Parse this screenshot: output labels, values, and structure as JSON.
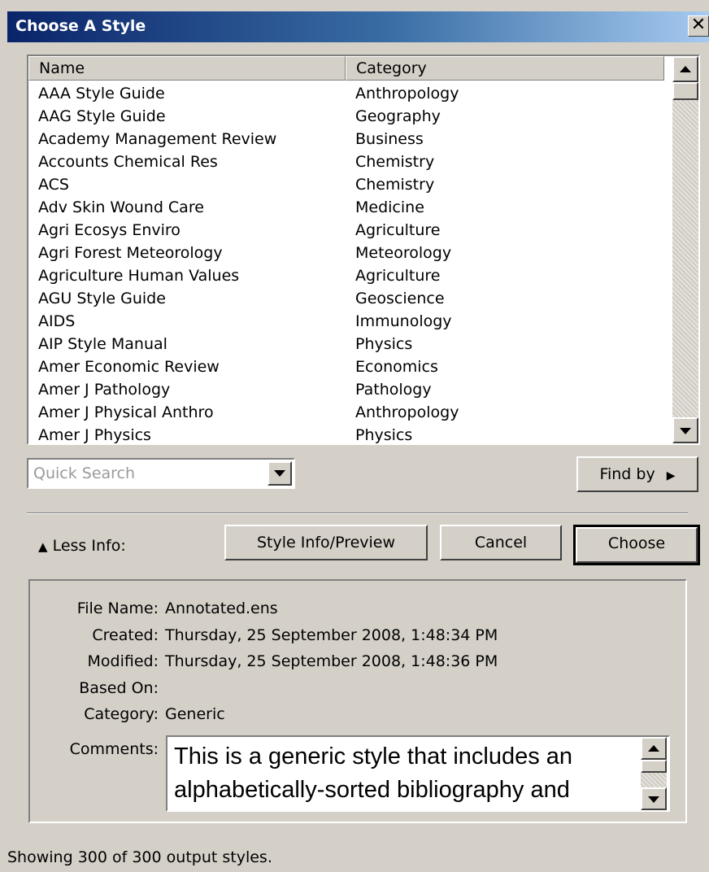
{
  "window": {
    "title": "Choose A Style",
    "close_label": "✕"
  },
  "list": {
    "columns": [
      "Name",
      "Category"
    ],
    "rows": [
      [
        "AAA Style Guide",
        "Anthropology"
      ],
      [
        "AAG Style Guide",
        "Geography"
      ],
      [
        "Academy Management Review",
        "Business"
      ],
      [
        "Accounts Chemical Res",
        "Chemistry"
      ],
      [
        "ACS",
        "Chemistry"
      ],
      [
        "Adv Skin Wound Care",
        "Medicine"
      ],
      [
        "Agri Ecosys Enviro",
        "Agriculture"
      ],
      [
        "Agri Forest Meteorology",
        "Meteorology"
      ],
      [
        "Agriculture Human Values",
        "Agriculture"
      ],
      [
        "AGU Style Guide",
        "Geoscience"
      ],
      [
        "AIDS",
        "Immunology"
      ],
      [
        "AIP Style Manual",
        "Physics"
      ],
      [
        "Amer Economic Review",
        "Economics"
      ],
      [
        "Amer J Pathology",
        "Pathology"
      ],
      [
        "Amer J Physical Anthro",
        "Anthropology"
      ],
      [
        "Amer J Physics",
        "Physics"
      ]
    ]
  },
  "search": {
    "placeholder": "Quick Search"
  },
  "buttons": {
    "find_by": "Find by",
    "less_info": "Less Info:",
    "style_info": "Style Info/Preview",
    "cancel": "Cancel",
    "choose": "Choose"
  },
  "info": {
    "file_name_label": "File Name:",
    "file_name": "Annotated.ens",
    "created_label": "Created:",
    "created": "Thursday, 25 September 2008, 1:48:34 PM",
    "modified_label": "Modified:",
    "modified": "Thursday, 25 September 2008, 1:48:36 PM",
    "based_on_label": "Based On:",
    "based_on": "",
    "category_label": "Category:",
    "category": "Generic",
    "comments_label": "Comments:",
    "comments": "This is a generic style that includes an alphabetically-sorted bibliography and"
  },
  "status": "Showing 300 of 300 output styles."
}
